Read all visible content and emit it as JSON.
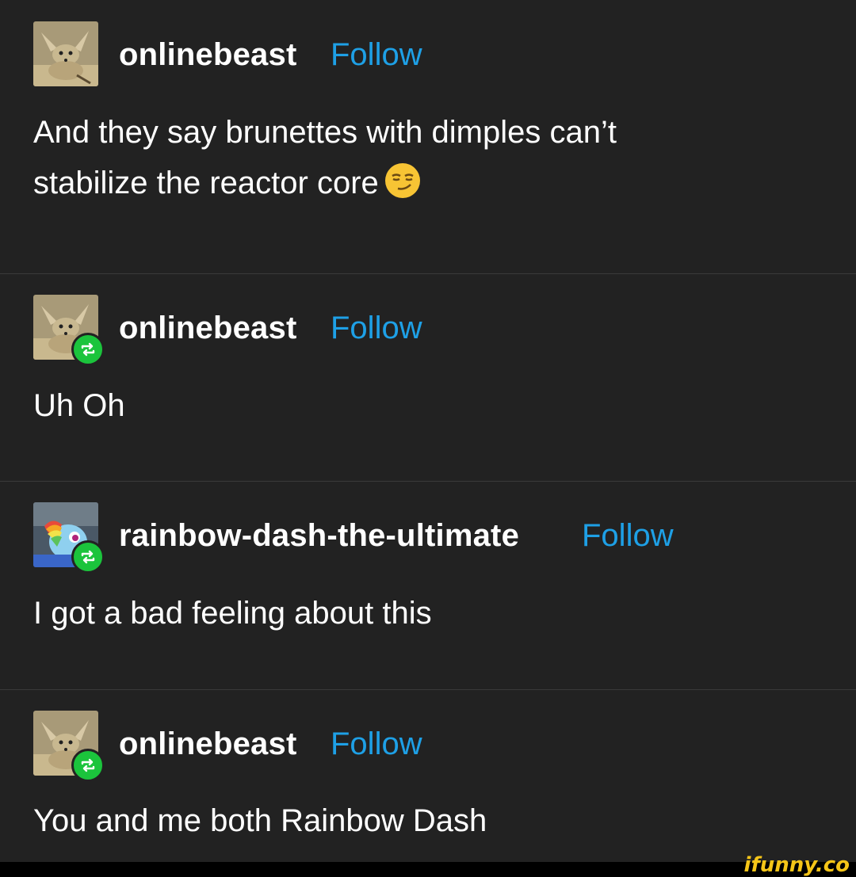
{
  "posts": [
    {
      "username": "onlinebeast",
      "follow": "Follow",
      "text_lines": [
        "And they say brunettes with dimples can’t",
        "stabilize the reactor core"
      ],
      "has_emoji": true,
      "reblog": false,
      "avatar": "fennec-fox-avatar"
    },
    {
      "username": "onlinebeast",
      "follow": "Follow",
      "text_lines": [
        "Uh Oh"
      ],
      "reblog": true,
      "avatar": "fennec-fox-avatar"
    },
    {
      "username": "rainbow-dash-the-ultimate",
      "follow": "Follow",
      "text_lines": [
        "I got a bad feeling about this"
      ],
      "reblog": true,
      "avatar": "rainbow-dash-avatar"
    },
    {
      "username": "onlinebeast",
      "follow": "Follow",
      "text_lines": [
        "You and me both Rainbow Dash"
      ],
      "reblog": true,
      "avatar": "fennec-fox-avatar"
    }
  ],
  "emoji": "smirking-face-icon",
  "watermark": "ifunny.co",
  "colors": {
    "background": "#222222",
    "follow": "#1ea0e6",
    "reblog_badge": "#1bc43c",
    "watermark": "#f5c518"
  }
}
